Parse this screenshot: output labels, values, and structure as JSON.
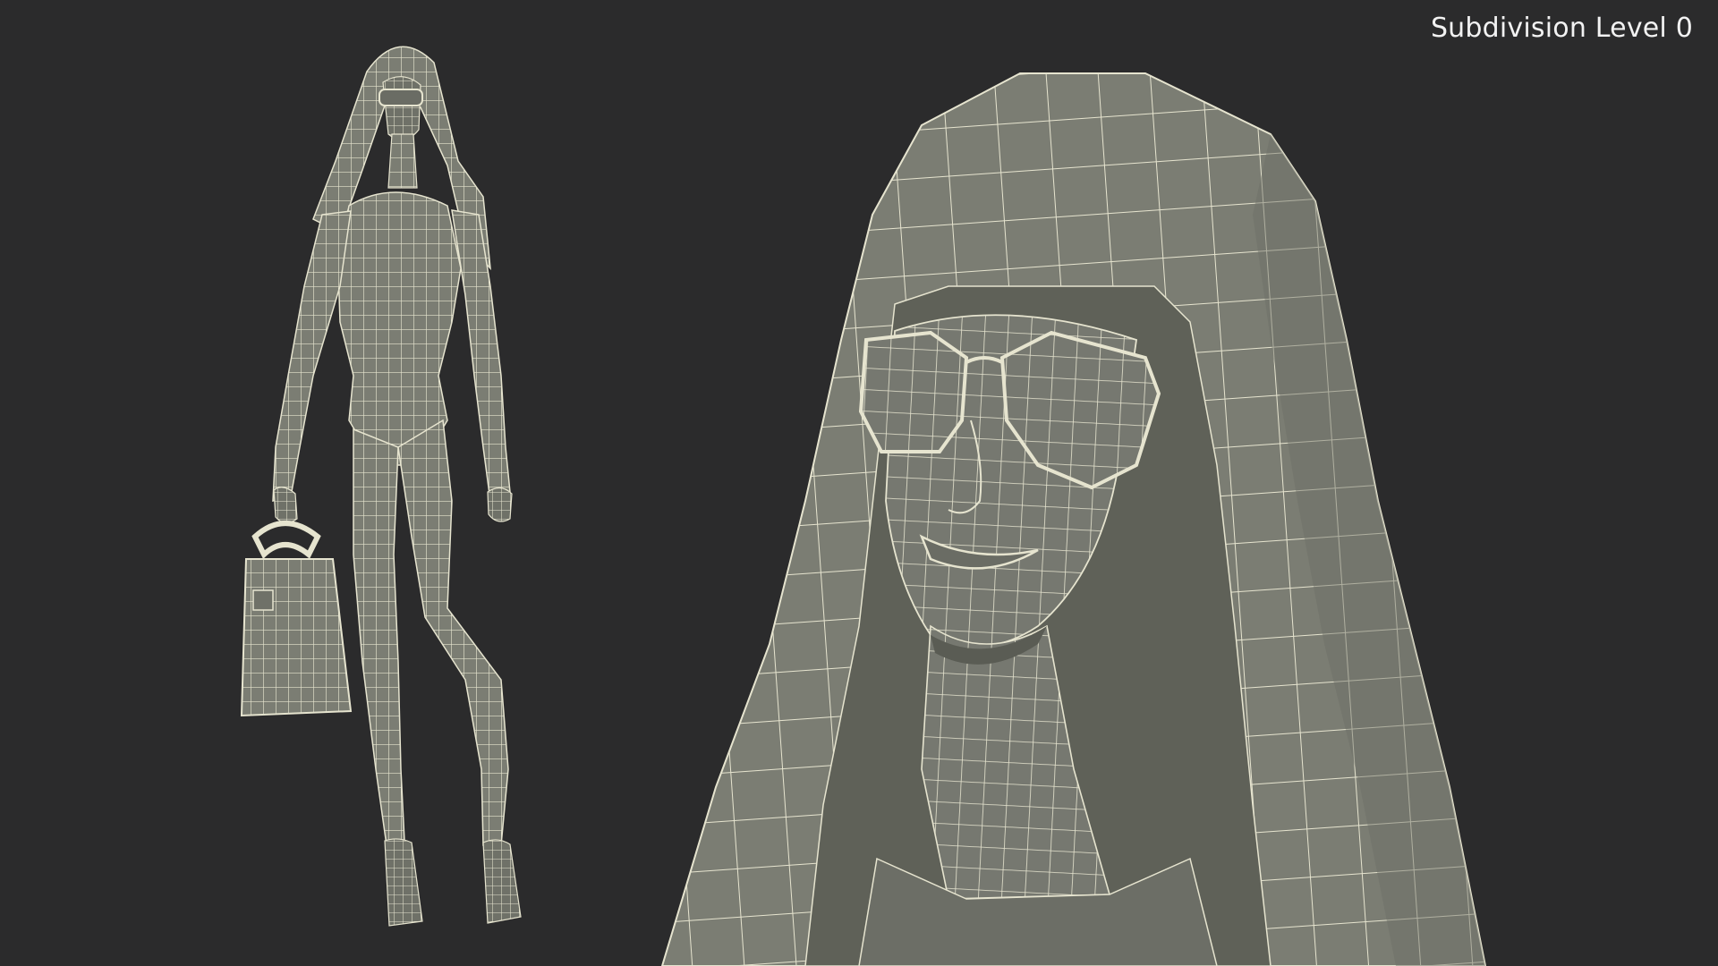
{
  "caption": {
    "text": "Subdivision Level 0"
  },
  "scene": {
    "background_color": "#2b2b2c",
    "mesh_fill_color": "#7b7d73",
    "mesh_shadow_color": "#5f6158",
    "wire_color": "#e6e4cf",
    "views": [
      {
        "name": "full-body-wireframe",
        "subject": "standing woman with hood, sunglasses and handbag"
      },
      {
        "name": "head-closeup-wireframe",
        "subject": "hooded head with sunglasses"
      }
    ]
  }
}
